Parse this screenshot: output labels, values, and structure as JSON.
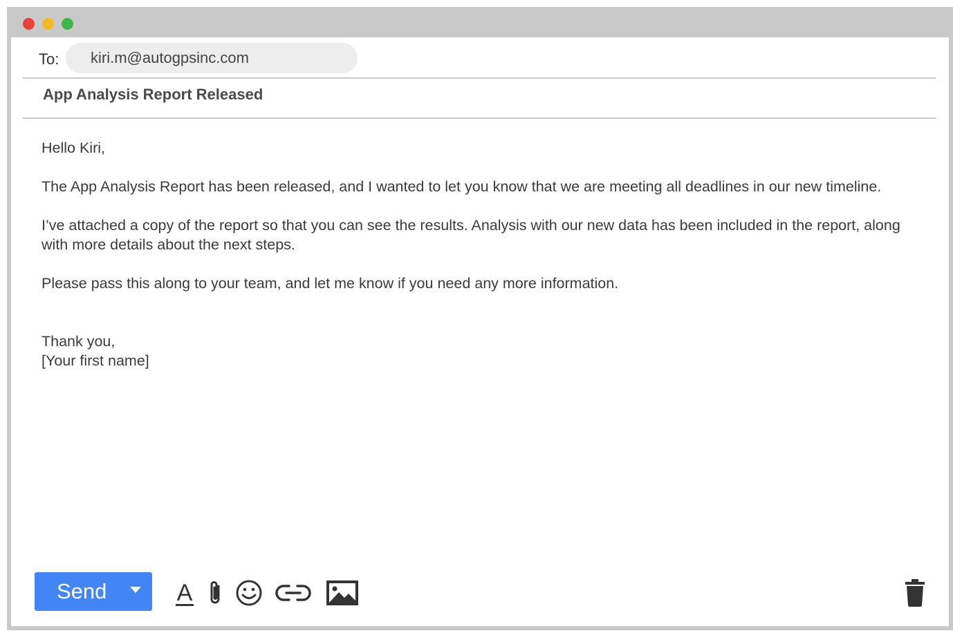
{
  "compose": {
    "to_label": "To:",
    "to_value": "kiri.m@autogpsinc.com",
    "subject": "App Analysis Report Released",
    "body": {
      "greeting": "Hello Kiri,",
      "paragraph1": "The App Analysis Report has been released, and I wanted to let you know that we are meeting all deadlines in our new timeline.",
      "paragraph2": "I’ve attached a copy of the report so that you can see the results. Analysis with our new data  has been included in the report, along with more details about the next steps.",
      "paragraph3": "Please pass this along to your team, and let me know if you need any more information.",
      "closing": "Thank you,",
      "signature": "[Your first name]"
    }
  },
  "toolbar": {
    "send_label": "Send",
    "format_icon_letter": "A",
    "icons": [
      "text-format-icon",
      "paperclip-icon",
      "emoji-icon",
      "link-icon",
      "image-icon",
      "trash-icon"
    ]
  },
  "colors": {
    "send_button": "#4285f4",
    "titlebar": "#c9c9c9",
    "close_dot": "#e8423b",
    "minimize_dot": "#f4b826",
    "maximize_dot": "#3fb54a"
  }
}
